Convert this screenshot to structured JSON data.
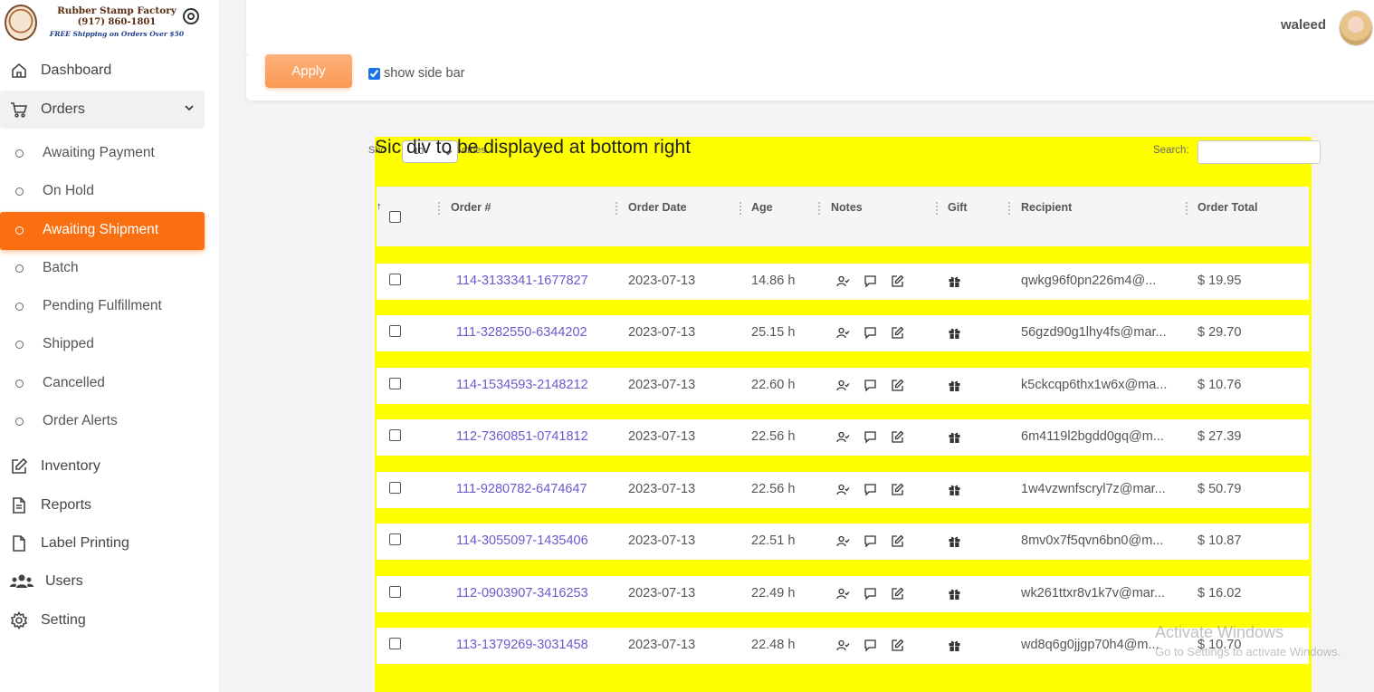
{
  "brand": {
    "name": "Rubber Stamp Factory",
    "phone": "(917) 860-1801",
    "shipping": "FREE Shipping on Orders Over $50"
  },
  "nav": {
    "dashboard": "Dashboard",
    "orders": "Orders",
    "sub": [
      "Awaiting Payment",
      "On Hold",
      "Awaiting Shipment",
      "Batch",
      "Pending Fulfillment",
      "Shipped",
      "Cancelled",
      "Order Alerts"
    ],
    "active_sub": "Awaiting Shipment",
    "inventory": "Inventory",
    "reports": "Reports",
    "label_printing": "Label Printing",
    "users": "Users",
    "setting": "Setting"
  },
  "header": {
    "user_name": "waleed"
  },
  "filters": {
    "apply_label": "Apply",
    "show_sidebar_label": "show side bar",
    "show_sidebar_checked": true
  },
  "table_area": {
    "overlay_text": "Sic      div to be displayed at bottom right",
    "length_prefix": "Sho",
    "length_value": "10",
    "length_suffix": "ntries",
    "search_label": "Search:"
  },
  "table": {
    "sort_indicator": "↑",
    "columns": [
      "Order #",
      "Order Date",
      "Age",
      "Notes",
      "Gift",
      "Recipient",
      "Order Total"
    ],
    "rows": [
      {
        "order": "114-3133341-1677827",
        "date": "2023-07-13",
        "age": "14.86 h",
        "recipient": "qwkg96f0pn226m4@...",
        "total": "$ 19.95"
      },
      {
        "order": "111-3282550-6344202",
        "date": "2023-07-13",
        "age": "25.15 h",
        "recipient": "56gzd90g1lhy4fs@mar...",
        "total": "$ 29.70"
      },
      {
        "order": "114-1534593-2148212",
        "date": "2023-07-13",
        "age": "22.60 h",
        "recipient": "k5ckcqp6thx1w6x@ma...",
        "total": "$ 10.76"
      },
      {
        "order": "112-7360851-0741812",
        "date": "2023-07-13",
        "age": "22.56 h",
        "recipient": "6m4119l2bgdd0gq@m...",
        "total": "$ 27.39"
      },
      {
        "order": "111-9280782-6474647",
        "date": "2023-07-13",
        "age": "22.56 h",
        "recipient": "1w4vzwnfscryl7z@mar...",
        "total": "$ 50.79"
      },
      {
        "order": "114-3055097-1435406",
        "date": "2023-07-13",
        "age": "22.51 h",
        "recipient": "8mv0x7f5qvn6bn0@m...",
        "total": "$ 10.87"
      },
      {
        "order": "112-0903907-3416253",
        "date": "2023-07-13",
        "age": "22.49 h",
        "recipient": "wk261ttxr8v1k7v@mar...",
        "total": "$ 16.02"
      },
      {
        "order": "113-1379269-3031458",
        "date": "2023-07-13",
        "age": "22.48 h",
        "recipient": "wd8q6g0jjgp70h4@m...",
        "total": "$ 10.70"
      }
    ]
  },
  "watermark": {
    "line1": "Activate Windows",
    "line2": "Go to Settings to activate Windows."
  },
  "colors": {
    "accent": "#f96f12",
    "highlight": "#ffff00",
    "link": "#6a5acd"
  }
}
